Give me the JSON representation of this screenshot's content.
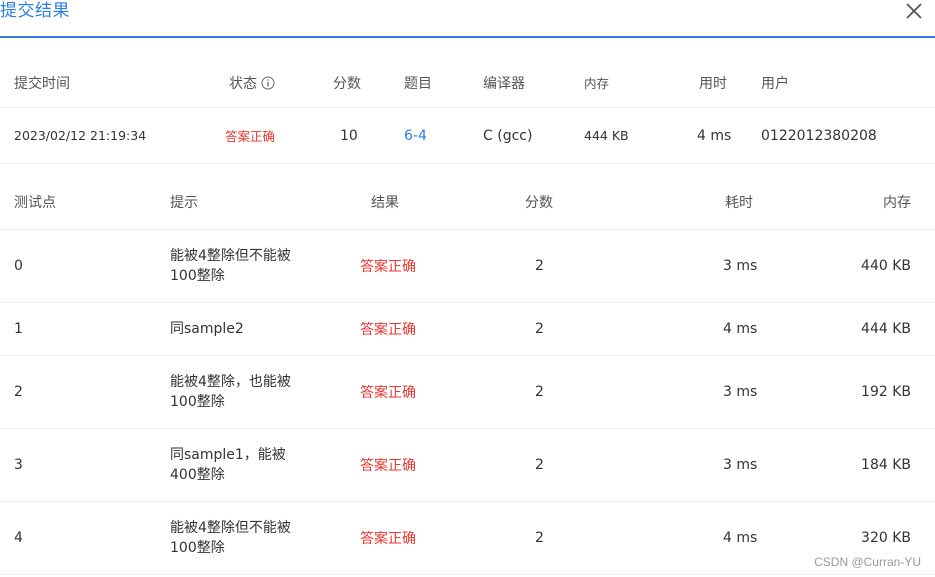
{
  "dialog": {
    "title": "提交结果"
  },
  "summary": {
    "headers": {
      "time": "提交时间",
      "status": "状态",
      "score": "分数",
      "problem": "题目",
      "compiler": "编译器",
      "memory": "内存",
      "time_used": "用时",
      "user": "用户"
    },
    "row": {
      "time": "2023/02/12 21:19:34",
      "status": "答案正确",
      "score": "10",
      "problem": "6-4",
      "compiler": "C (gcc)",
      "memory": "444 KB",
      "time_used": "4 ms",
      "user": "0122012380208"
    }
  },
  "tests": {
    "headers": {
      "point": "测试点",
      "hint": "提示",
      "result": "结果",
      "score": "分数",
      "time": "耗时",
      "memory": "内存"
    },
    "rows": [
      {
        "point": "0",
        "hint": "能被4整除但不能被100整除",
        "result": "答案正确",
        "score": "2",
        "time": "3 ms",
        "memory": "440 KB"
      },
      {
        "point": "1",
        "hint": "同sample2",
        "result": "答案正确",
        "score": "2",
        "time": "4 ms",
        "memory": "444 KB"
      },
      {
        "point": "2",
        "hint": "能被4整除，也能被100整除",
        "result": "答案正确",
        "score": "2",
        "time": "3 ms",
        "memory": "192 KB"
      },
      {
        "point": "3",
        "hint": "同sample1，能被400整除",
        "result": "答案正确",
        "score": "2",
        "time": "3 ms",
        "memory": "184 KB"
      },
      {
        "point": "4",
        "hint": "能被4整除但不能被100整除",
        "result": "答案正确",
        "score": "2",
        "time": "4 ms",
        "memory": "320 KB"
      }
    ]
  },
  "watermark": "CSDN @Curran-YU",
  "icons": {
    "close": "close-icon",
    "info": "info-icon"
  },
  "colors": {
    "accent": "#2f7fe0",
    "success_text": "#e53935"
  }
}
